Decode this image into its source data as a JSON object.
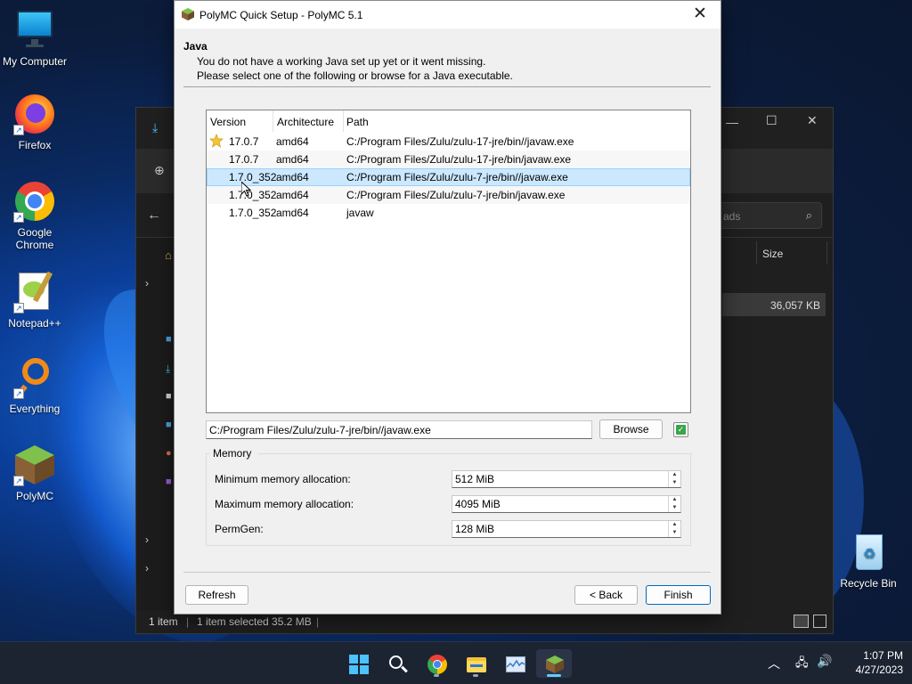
{
  "desktop": {
    "icons": [
      {
        "label": "My Computer"
      },
      {
        "label": "Firefox"
      },
      {
        "label": "Google Chrome"
      },
      {
        "label": "Notepad++"
      },
      {
        "label": "Everything"
      },
      {
        "label": "PolyMC"
      },
      {
        "label": "Recycle Bin"
      }
    ]
  },
  "explorer": {
    "search_placeholder": "ads",
    "column_size": "Size",
    "file_size": "36,057 KB",
    "status_items": "1 item",
    "status_selected": "1 item selected  35.2 MB"
  },
  "dialog": {
    "title": "PolyMC Quick Setup - PolyMC 5.1",
    "heading": "Java",
    "desc_line1": "You do not have a working Java set up yet or it went missing.",
    "desc_line2": "Please select one of the following or browse for a Java executable.",
    "table": {
      "columns": [
        "Version",
        "Architecture",
        "Path"
      ],
      "rows": [
        {
          "version": "17.0.7",
          "arch": "amd64",
          "path": "C:/Program Files/Zulu/zulu-17-jre/bin//javaw.exe",
          "recommended": true
        },
        {
          "version": "17.0.7",
          "arch": "amd64",
          "path": "C:/Program Files/Zulu/zulu-17-jre/bin/javaw.exe",
          "recommended": false
        },
        {
          "version": "1.7.0_352",
          "arch": "amd64",
          "path": "C:/Program Files/Zulu/zulu-7-jre/bin//javaw.exe",
          "recommended": false,
          "selected": true
        },
        {
          "version": "1.7.0_352",
          "arch": "amd64",
          "path": "C:/Program Files/Zulu/zulu-7-jre/bin/javaw.exe",
          "recommended": false
        },
        {
          "version": "1.7.0_352",
          "arch": "amd64",
          "path": "javaw",
          "recommended": false
        }
      ]
    },
    "java_path": "C:/Program Files/Zulu/zulu-7-jre/bin//javaw.exe",
    "browse_label": "Browse",
    "java_valid": true,
    "memory": {
      "group_title": "Memory",
      "min_label": "Minimum memory allocation:",
      "min_value": "512 MiB",
      "max_label": "Maximum memory allocation:",
      "max_value": "4095 MiB",
      "permgen_label": "PermGen:",
      "permgen_value": "128 MiB"
    },
    "refresh_label": "Refresh",
    "back_label": "< Back",
    "finish_label": "Finish"
  },
  "taskbar": {
    "apps": [
      "start-icon",
      "search-icon",
      "chrome-icon",
      "file-explorer-icon",
      "task-manager-icon",
      "polymc-icon"
    ],
    "time": "1:07 PM",
    "date": "4/27/2023"
  },
  "colors": {
    "selection": "#cce8ff",
    "accent": "#0067c0",
    "taskbar": "#1c2331"
  }
}
